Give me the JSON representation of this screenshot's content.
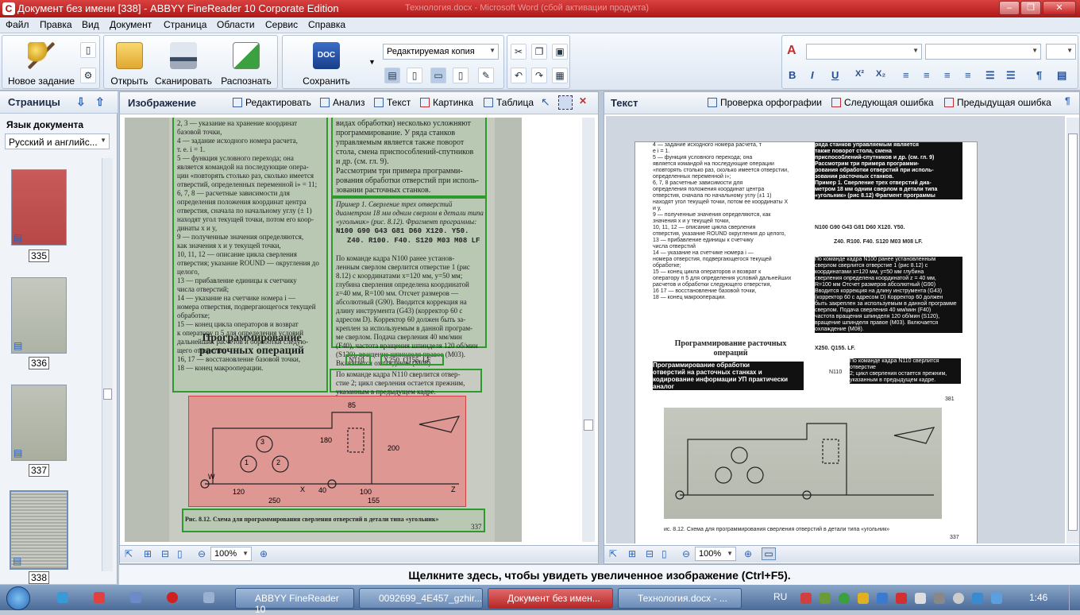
{
  "window": {
    "title": "Документ без имени [338] - ABBYY FineReader 10 Corporate Edition",
    "ghost_title": "Технология.docx - Microsoft Word (сбой активации продукта)",
    "minimize": "–",
    "restore": "❐",
    "close": "✕",
    "accent": "#c41e1e"
  },
  "menu": [
    "Файл",
    "Правка",
    "Вид",
    "Документ",
    "Страница",
    "Области",
    "Сервис",
    "Справка"
  ],
  "toolbar": {
    "new_task": "Новое задание",
    "open": "Открыть",
    "scan": "Сканировать",
    "recognize": "Распознать",
    "save": "Сохранить",
    "save_icon_text": "DOC W",
    "copy_mode": "Редактируемая копия"
  },
  "pages_panel": {
    "title": "Страницы",
    "lang_label": "Язык документа",
    "lang_value": "Русский и английс...",
    "thumbs": [
      {
        "num": "335"
      },
      {
        "num": "336"
      },
      {
        "num": "337"
      },
      {
        "num": "338"
      }
    ]
  },
  "image_panel": {
    "title": "Изображение",
    "edit": "Редактировать",
    "analyze": "Анализ",
    "text": "Текст",
    "picture": "Картинка",
    "table": "Таблица",
    "zoom": "100%",
    "scan_left_lines": [
      "2, 3 — указание на хранение координат",
      "базовой точки,",
      "4 — задание исходного номера расчета,",
      "т. е. i = 1.",
      "5 — функция условного перехода; она",
      "является командой на последующие опера-",
      "ции «повторять столько раз, сколько имеется",
      "отверстий, определенных переменной i» = 11;",
      "6, 7, 8 — расчетные зависимости для",
      "определения положения координат центра",
      "отверстия, сначала по начальному углу (± 1)",
      "находят угол текущей точки, потом его коор-",
      "динаты x и y,",
      "9 — полученные значения определяются,",
      "как значения x и y текущей точки,",
      "10, 11, 12 — описание цикла сверления",
      "отверстия; указание ROUND — округления до",
      "целого,",
      "13 — прибавление единицы к счетчику",
      "числа отверстий;",
      "14 — указание на счетчике номера i —",
      "номера отверстия, подвергающегося текущей",
      "обработке;",
      "15 — конец цикла операторов и возврат",
      "к оператору п 5 для определения условий",
      "дальнейших расчетов и обработки следую-",
      "щего отверстия;",
      "16, 17 — восстановление базовой точки,",
      "18 — конец макрооперации."
    ],
    "scan_heading": "Программирование расточных операций",
    "scan_right_lines": [
      "видах обработки) несколько усложняют",
      "программирование. У ряда станков",
      "управляемым является также поворот",
      "стола, смена приспособлений-спутников",
      "и др. (см. гл. 9).",
      "Рассмотрим три примера программи-",
      "рования обработки отверстий при исполь-",
      "зовании расточных станков."
    ],
    "scan_example": "Пример 1. Сверление трех отверстий диаметром 18 мм одним сверлом в детали типа «угольник» (рис. 8.12). Фрагмент программы:",
    "scan_code": [
      "N100 G90 G43 G81 D60 X120. Y50.",
      "Z40. R100. F40. S120 M03 M08 LF"
    ],
    "scan_para": [
      "По команде кадра N100 ранее установ-",
      "ленным сверлом сверлится отверстие 1 (рис",
      "8.12) с координатами x=120 мм, y=50 мм;",
      "глубина сверления определена координатой",
      "z=40 мм, R=100 мм. Отсчет размеров —",
      "абсолютный (G90). Вводится коррекция на",
      "длину инструмента (G43) (корректор 60 с",
      "адресом D). Корректор 60 должен быть за-",
      "креплен за используемым в данной програм-",
      "ме сверлом. Подача сверления 40 мм/мин",
      "(F40), частота вращения шпинделя 120 об/мин",
      "(S120), вращение шпинделя правое (M03).",
      "Включается охлаждение (M08)."
    ],
    "scan_small": [
      "N110",
      "X250. Q155. LF"
    ],
    "scan_n110": [
      "По команде кадра N110 сверлится отвер-",
      "стие 2; цикл сверления остается прежним,",
      "указанным в предыдущем кадре."
    ],
    "scan_caption": "Рис. 8.12. Схема для программирования сверления отверстий в детали типа «угольник»",
    "scan_page": "337",
    "dims": [
      "85",
      "120",
      "250",
      "40",
      "100",
      "155",
      "200",
      "180",
      "W",
      "X",
      "Z",
      "1",
      "2",
      "3"
    ]
  },
  "text_panel": {
    "title": "Текст",
    "spell": "Проверка орфографии",
    "next_err": "Следующая ошибка",
    "prev_err": "Предыдущая ошибка",
    "zoom": "100%",
    "col1": [
      "4 — задание исходного номера расчета, т",
      "е i = 1.",
      "5 — функция условного перехода; она",
      "является командой на последующие операции",
      "«повторять столько раз, сколько имеется отверстии,",
      "определенных переменной i»;",
      "6, 7, 8 расчетные зависимости для",
      "определения положения координат центра",
      "отверстия, сначала по начальному углу (±1 1)",
      "находят угол текущей точки, потом ее координаты X",
      "и у,",
      "9 — полученные значения определяются, как",
      "значения х и у текущей точки,",
      "10, 11, 12 — описание цикла сверления",
      "отверстия, указание ROUND округления до целого,",
      "13 — прибавление единицы к счетчику",
      "числа отверстий",
      "14 — указание на счетчике номера i —",
      "номера отверстия, подвергающегося текущей",
      "обработке;",
      "15 — конец цикла операторов и возврат к",
      "оператору п 5 для определения условий дальнейших",
      "расчетов и обработки следующего отверстия,",
      "16 17 — восстановление базовой точки,",
      "18 — конец макрооперации."
    ],
    "heading": "Программирование расточных операций",
    "col1_bottom": [
      "Программирование обработки",
      "отверстий на расточных станках и",
      "кодирование информации УП практически",
      "аналог"
    ],
    "col2": [
      "ряда станков управляемым является",
      "также поворот стола, смена",
      "приспособлений-спутников и др. (см. гл. 9)",
      "Рассмотрим три примера программи-",
      "рования обработки отверстий при исполь-",
      "зовании расточных станков.",
      "Пример 1. Сверление трех отверстий диа-",
      "метром 18 мм одним сверлом в детали типа",
      "«угольник» (рис 8.12) Фрагмент программы"
    ],
    "code1": "N100 G90 G43 G81 D60 X120. Y50.",
    "code2": "Z40. R100. F40. S120 M03 M08 LF.",
    "col2_para": [
      "По команде кадра N100 ранее установленным",
      "сверлом сверлится отверстие 1 (рис 8.12) с",
      "координатами x=120 мм, y=50 мм глубина",
      "сверления определена координатой z = 40 мм,",
      "R=100 мм Отсчет размеров абсолютный (G90)",
      "Вводится коррекция на длину инструмента (G43)",
      "(корректор 60 с адресом D) Корректор 60 должен",
      "быть закреплен за используемым в данной программе",
      "сверлом. Подача сверления 40 мм/мин (F40)",
      "частота вращения шпинделя 120 об/мин (S120),",
      "вращение шпинделя правое (M03). Включается",
      "охлаждение (M08)."
    ],
    "code3": "X250. Q155. LF.",
    "col2_n110": [
      "По команде кадра N110 сверлится отверстие",
      "2; цикл сверления остается прежним,",
      "указанным в предыдущем кадре."
    ],
    "n110_tag": "N110",
    "page_ref": "381",
    "caption": "ис. 8.12. Схема для программирования сверления отверстий в детали типа «угольник»",
    "page": "337"
  },
  "hint": "Щелкните здесь, чтобы увидеть увеличенное изображение (Ctrl+F5).",
  "taskbar": {
    "items": [
      "ABBYY FineReader 10",
      "0092699_4E457_gzhir...",
      "Документ без имен...",
      "Технология.docx - ..."
    ],
    "lang": "RU",
    "time": "1:46"
  }
}
